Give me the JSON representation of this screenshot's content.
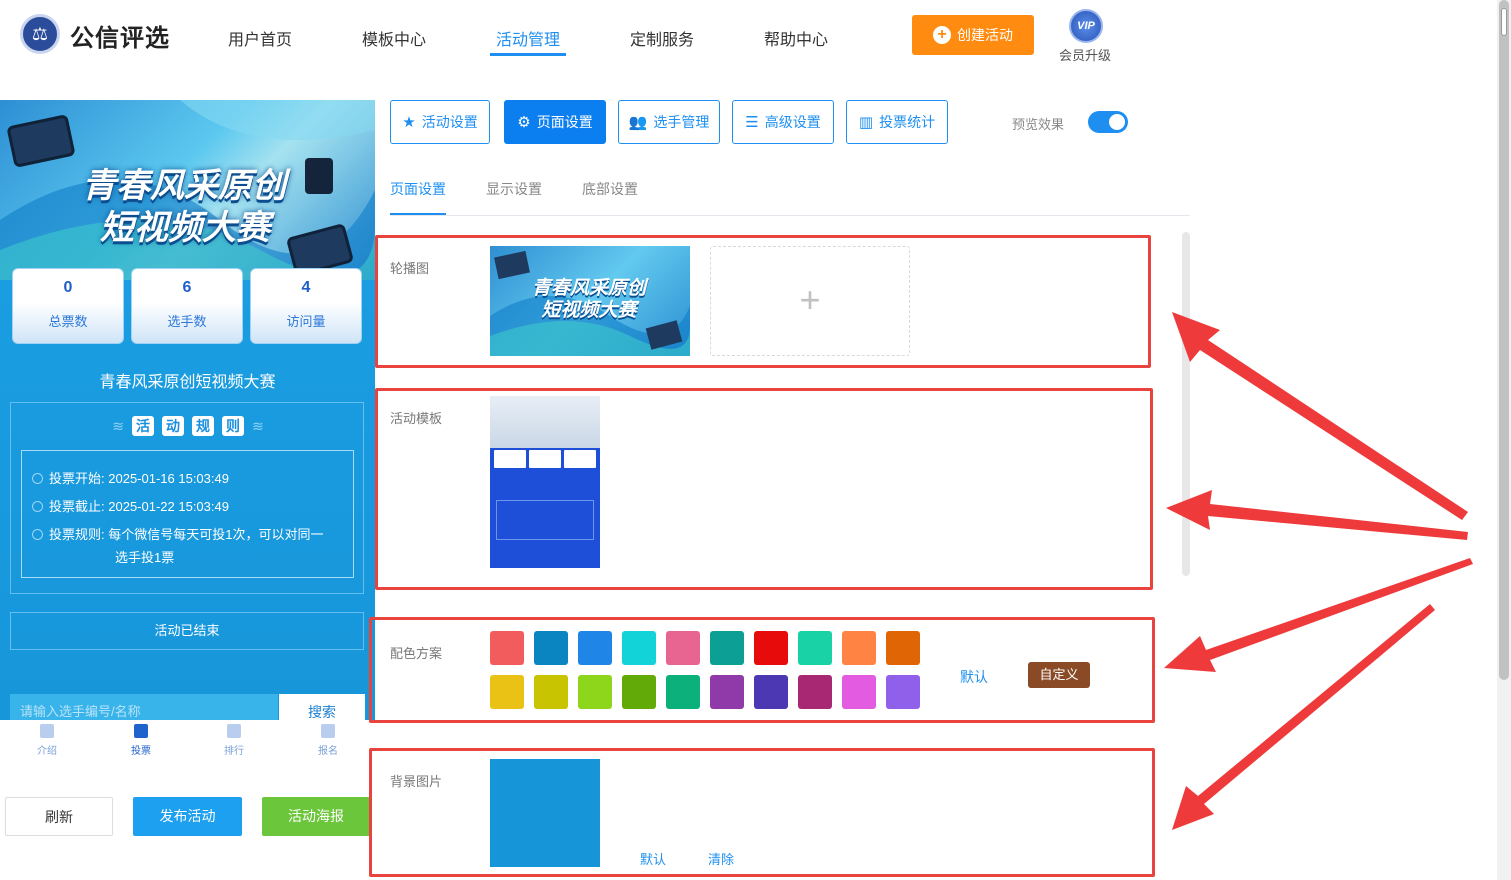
{
  "header": {
    "logo_text": "公信评选",
    "nav": [
      "用户首页",
      "模板中心",
      "活动管理",
      "定制服务",
      "帮助中心"
    ],
    "active_nav": "活动管理",
    "create_label": "创建活动",
    "vip_badge": "VIP",
    "vip_label": "会员升级"
  },
  "preview": {
    "banner_line1": "青春风采原创",
    "banner_line2": "短视频大赛",
    "stats": [
      {
        "value": "0",
        "label": "总票数"
      },
      {
        "value": "6",
        "label": "选手数"
      },
      {
        "value": "4",
        "label": "访问量"
      }
    ],
    "activity_title": "青春风采原创短视频大赛",
    "rules_heading": [
      "活",
      "动",
      "规",
      "则"
    ],
    "rules": {
      "start_label": "投票开始:",
      "start_value": "2025-01-16 15:03:49",
      "end_label": "投票截止:",
      "end_value": "2025-01-22 15:03:49",
      "rule_label": "投票规则:",
      "rule_value_line1": "每个微信号每天可投1次，可以对同一",
      "rule_value_line2": "选手投1票"
    },
    "status": "活动已结束",
    "search_placeholder": "请输入选手编号/名称",
    "search_button": "搜索",
    "tabbar": [
      "介绍",
      "投票",
      "排行",
      "报名"
    ],
    "active_tab": "投票",
    "buttons": {
      "refresh": "刷新",
      "publish": "发布活动",
      "poster": "活动海报"
    }
  },
  "settings": {
    "top_buttons": [
      "活动设置",
      "页面设置",
      "选手管理",
      "高级设置",
      "投票统计"
    ],
    "active_top_button": "页面设置",
    "preview_toggle_label": "预览效果",
    "preview_toggle_on": true,
    "sub_tabs": [
      "页面设置",
      "显示设置",
      "底部设置"
    ],
    "active_sub_tab": "页面设置",
    "carousel_label": "轮播图",
    "carousel_image_line1": "青春风采原创",
    "carousel_image_line2": "短视频大赛",
    "add_icon": "+",
    "template_label": "活动模板",
    "color_label": "配色方案",
    "colors_row1": [
      "#f25c5c",
      "#0a85c2",
      "#1f86e8",
      "#12d3d8",
      "#e86591",
      "#0c9f96",
      "#e80b0b",
      "#19d3a6",
      "#ff8444",
      "#e06505"
    ],
    "colors_row2": [
      "#eac215",
      "#c9c402",
      "#8ed61c",
      "#62aa08",
      "#0cb07a",
      "#8f3aa8",
      "#4b38b2",
      "#a82873",
      "#e25be0",
      "#9160ea"
    ],
    "color_default": "默认",
    "color_custom": "自定义",
    "bg_label": "背景图片",
    "bg_color": "#1696d8",
    "bg_default": "默认",
    "bg_clear": "清除"
  }
}
